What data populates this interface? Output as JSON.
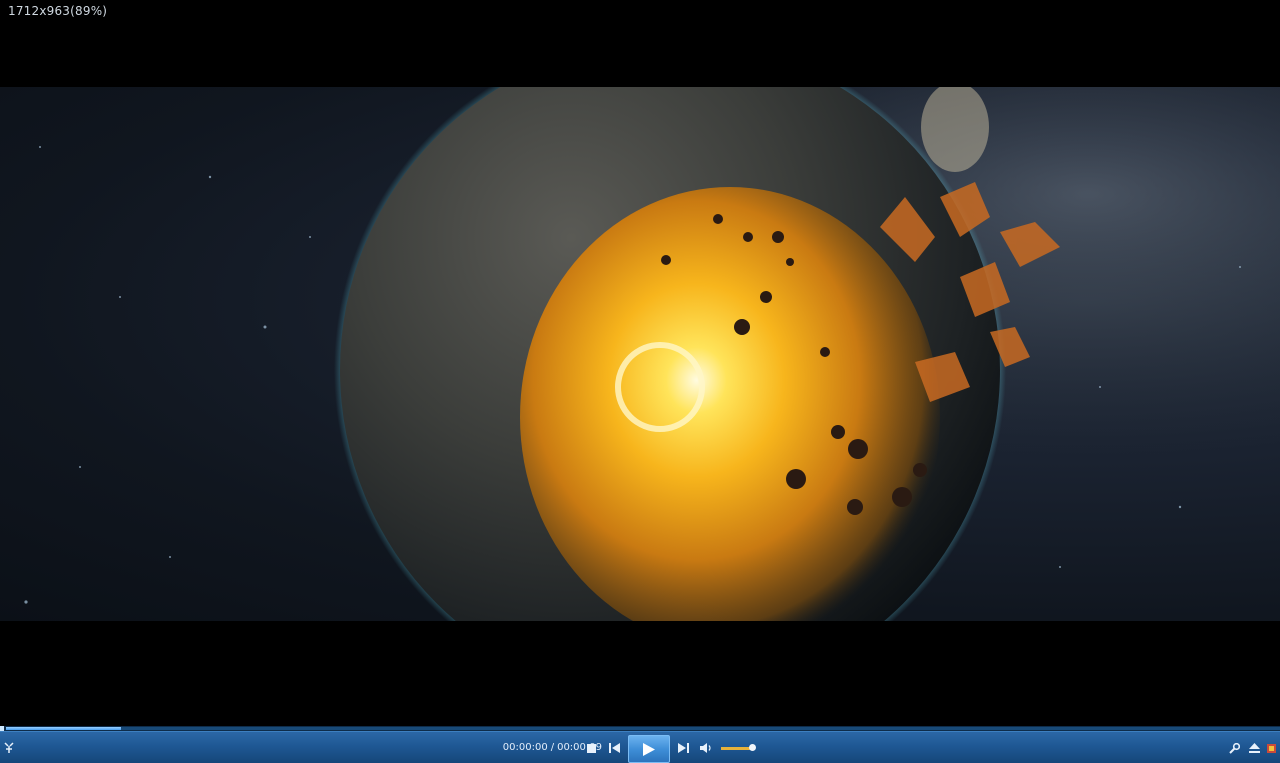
{
  "window": {
    "resolution_label": "1712x963(89%)"
  },
  "playback": {
    "current_time": "00:00:00",
    "separator": "/",
    "total_time": "00:00:09",
    "progress_fraction": 0.09,
    "volume_fraction": 0.92,
    "state": "paused"
  },
  "icons": {
    "logo": "player-logo-icon",
    "stop": "stop-icon",
    "prev": "skip-previous-icon",
    "play": "play-icon",
    "next": "skip-next-icon",
    "volume": "speaker-icon",
    "settings": "wrench-icon",
    "eject": "eject-icon",
    "skin": "skin-icon"
  },
  "colors": {
    "control_bar": "#1f5894",
    "play_button": "#3f8fd8",
    "volume_fill": "#e8b23a",
    "progress_fill": "#4aa0f0"
  }
}
